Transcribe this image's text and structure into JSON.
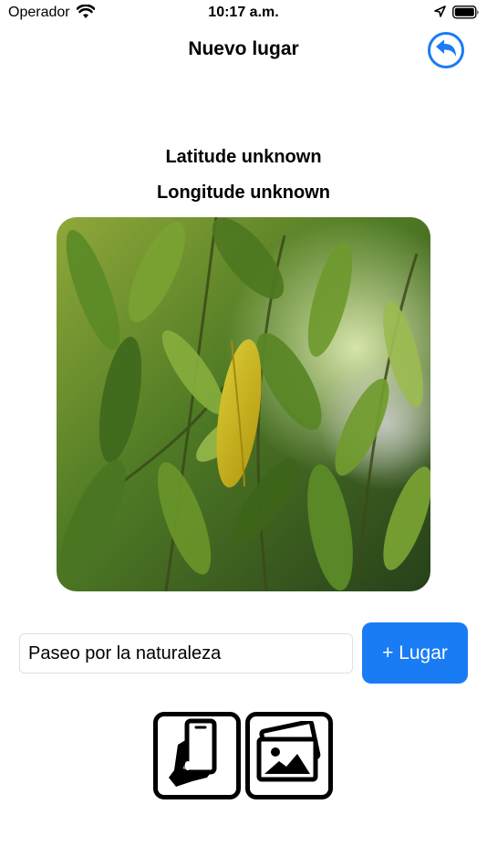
{
  "status_bar": {
    "carrier": "Operador",
    "time": "10:17 a.m.",
    "icons": [
      "wifi-icon",
      "location-arrow-icon",
      "battery-icon"
    ]
  },
  "nav": {
    "title": "Nuevo lugar",
    "back_icon": "back-arrow-icon"
  },
  "location": {
    "latitude_text": "Latitude unknown",
    "longitude_text": "Longitude unknown"
  },
  "photo": {
    "subject": "green-leaves-photo"
  },
  "form": {
    "name_value": "Paseo por la naturaleza",
    "add_label": "+ Lugar"
  },
  "actions": {
    "camera_icon": "hand-holding-phone-icon",
    "gallery_icon": "photo-gallery-icon"
  },
  "colors": {
    "accent": "#1a7cf5",
    "background": "#ffffff"
  }
}
